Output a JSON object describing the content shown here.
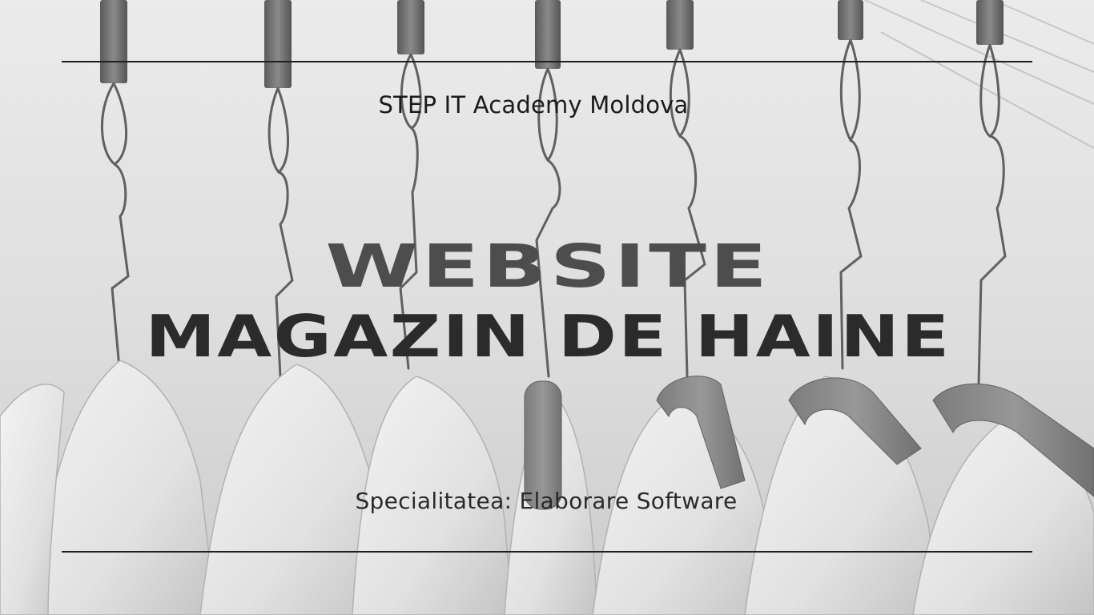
{
  "slide": {
    "academy": "STEP IT Academy Moldova",
    "title_line1": "WEBSITE",
    "title_line2": "MAGAZIN DE HAINE",
    "specialty": "Specialitatea: Elaborare Software"
  },
  "background": {
    "image": "clothes-hangers-photo",
    "tone": "grayscale"
  },
  "colors": {
    "rule": "#1f1f1f",
    "title_line1": "#4d4d4d",
    "title_line2": "#2b2b2b",
    "text": "#1b1b1b"
  }
}
